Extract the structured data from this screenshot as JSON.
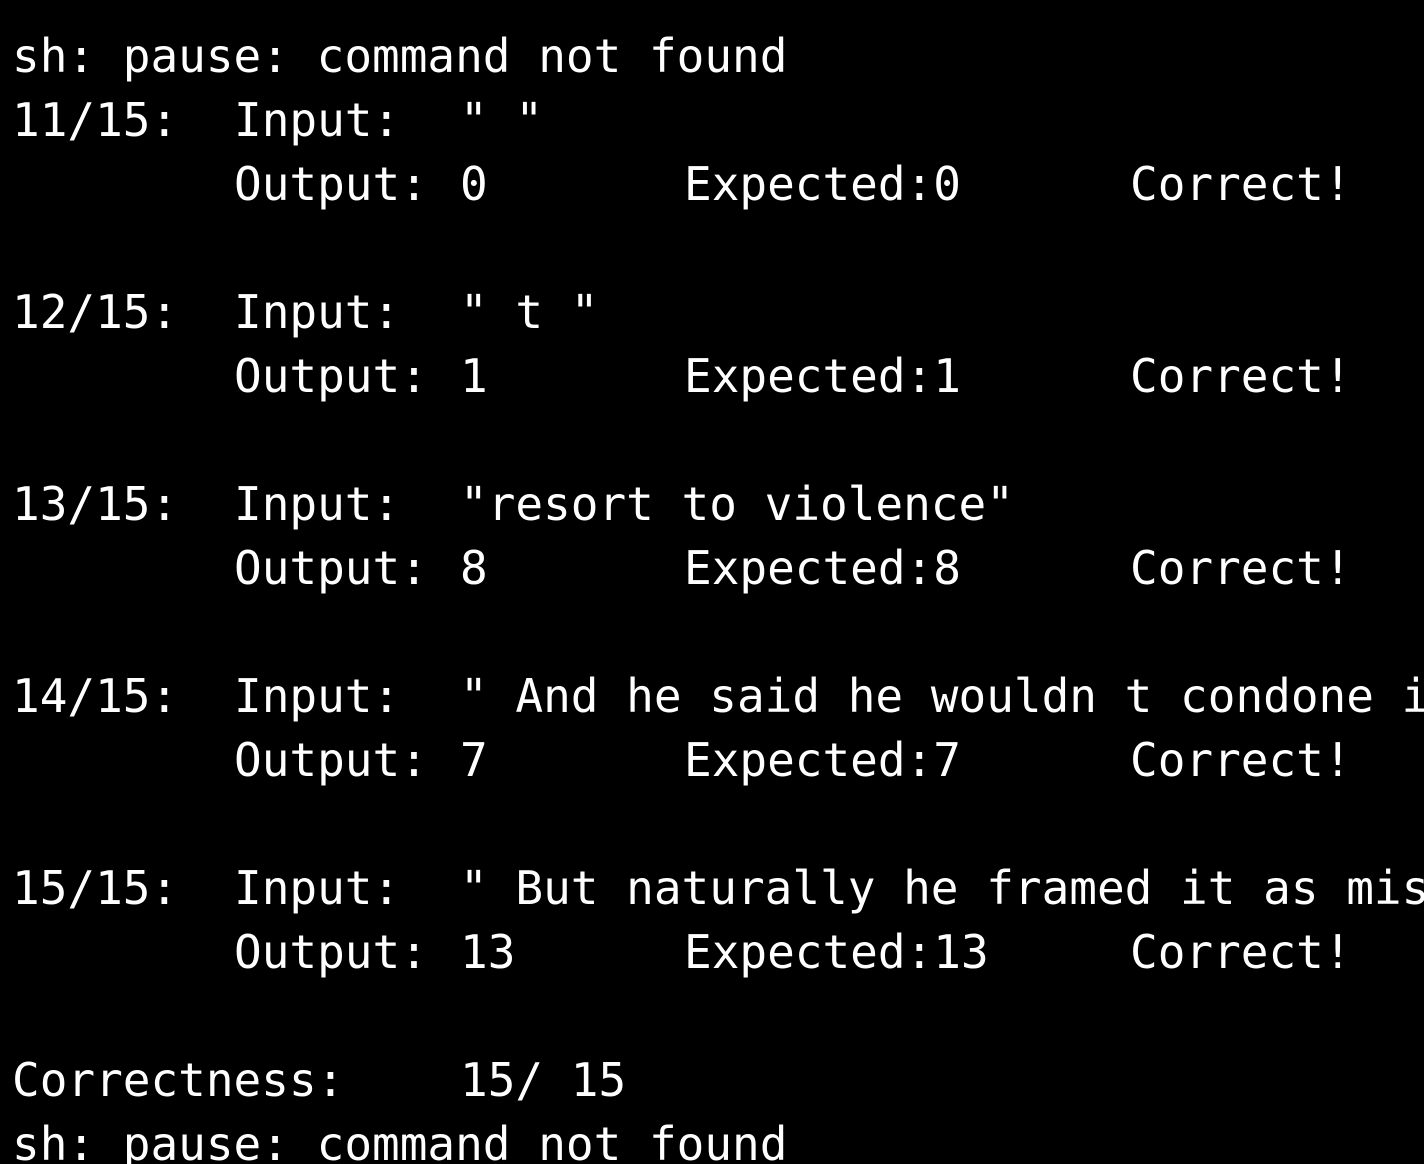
{
  "terminal": {
    "lines": [
      {
        "text": "sh: pause: command not found"
      },
      {
        "case": "11/15:",
        "label": "Input:",
        "input": "\" \""
      },
      {
        "output_label": "Output:",
        "output": "0",
        "expected": "Expected:0",
        "status": "Correct!"
      },
      {
        "case": "12/15:",
        "label": "Input:",
        "input": "\" t \""
      },
      {
        "output_label": "Output:",
        "output": "1",
        "expected": "Expected:1",
        "status": "Correct!"
      },
      {
        "case": "13/15:",
        "label": "Input:",
        "input": "\"resort to violence\""
      },
      {
        "output_label": "Output:",
        "output": "8",
        "expected": "Expected:8",
        "status": "Correct!"
      },
      {
        "case": "14/15:",
        "label": "Input:",
        "input": "\" And he said he wouldn t condone i"
      },
      {
        "output_label": "Output:",
        "output": "7",
        "expected": "Expected:7",
        "status": "Correct!"
      },
      {
        "case": "15/15:",
        "label": "Input:",
        "input": "\" But naturally he framed it as mis"
      },
      {
        "output_label": "Output:",
        "output": "13",
        "expected": "Expected:13",
        "status": "Correct!"
      },
      {
        "label": "Correctness:",
        "value": "15/ 15"
      },
      {
        "text": "sh: pause: command not found"
      }
    ]
  }
}
